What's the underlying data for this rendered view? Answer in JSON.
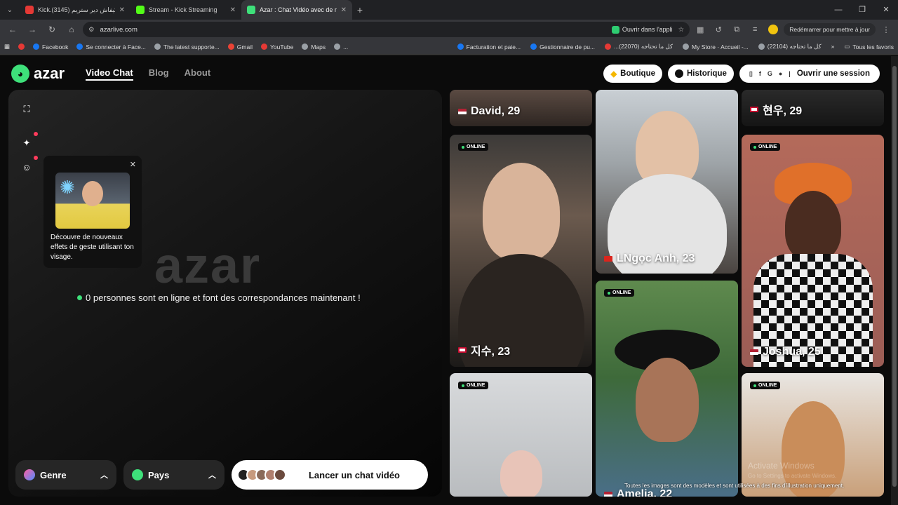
{
  "browser": {
    "tabs": [
      {
        "title": "Kick.ف كيفاش دير ستريم (3145)",
        "color": "#e53935",
        "active": false
      },
      {
        "title": "Stream - Kick Streaming",
        "color": "#53fc18",
        "active": false
      },
      {
        "title": "Azar : Chat Vidéo avec de nouv",
        "color": "#3ee07a",
        "active": true
      }
    ],
    "url": "azarlive.com",
    "open_app": "Ouvrir dans l'appli",
    "restart": "Redémarrer pour mettre à jour",
    "bookmarks": [
      {
        "label": "",
        "color": "#e53935"
      },
      {
        "label": "Facebook",
        "color": "#1877f2"
      },
      {
        "label": "Se connecter à Face...",
        "color": "#1877f2"
      },
      {
        "label": "The latest supporte...",
        "color": "#9aa0a6"
      },
      {
        "label": "Gmail",
        "color": "#ea4335"
      },
      {
        "label": "YouTube",
        "color": "#e53935"
      },
      {
        "label": "Maps",
        "color": "#9aa0a6"
      },
      {
        "label": "...",
        "color": "#9aa0a6"
      }
    ],
    "bookmarks_right": [
      {
        "label": "Facturation et paie...",
        "color": "#1877f2"
      },
      {
        "label": "Gestionnaire de pu...",
        "color": "#1877f2"
      },
      {
        "label": "...كل ما تحتاجه (22070)",
        "color": "#e53935"
      },
      {
        "label": "My Store · Accueil -...",
        "color": "#9aa0a6"
      },
      {
        "label": "كل ما تحتاجه (22104)",
        "color": "#9aa0a6"
      }
    ],
    "all_favorites": "Tous les favoris"
  },
  "header": {
    "logo": "azar",
    "nav": [
      {
        "label": "Video Chat",
        "active": true
      },
      {
        "label": "Blog",
        "active": false
      },
      {
        "label": "About",
        "active": false
      }
    ],
    "shop": "Boutique",
    "history": "Historique",
    "login": "Ouvrir une session"
  },
  "left": {
    "promo_text": "Découvre de nouveaux effets de geste utilisant ton visage.",
    "big_logo": "azar",
    "online_text": "0 personnes sont en ligne et font des correspondances maintenant !",
    "genre": "Genre",
    "country": "Pays",
    "start": "Lancer un chat vidéo"
  },
  "cards": [
    {
      "name": "David, 29",
      "flag": "us",
      "online": false
    },
    {
      "name": "현우, 29",
      "flag": "kr",
      "online": false
    },
    {
      "name": "지수, 23",
      "flag": "kr",
      "online": true
    },
    {
      "name": "LNgọc Anh, 23",
      "flag": "vn",
      "online": false
    },
    {
      "name": "Joshua, 25",
      "flag": "us",
      "online": true
    },
    {
      "name": "",
      "flag": "",
      "online": true
    },
    {
      "name": "Amelia, 22",
      "flag": "us",
      "online": true
    },
    {
      "name": "",
      "flag": "",
      "online": true
    }
  ],
  "online_label": "ONLINE",
  "watermark": {
    "line1": "Activate Windows",
    "line2": "Go to Settings to activate Windows."
  },
  "disclaimer": "Toutes les images sont des modèles et sont utilisées à des fins d'illustration uniquement."
}
